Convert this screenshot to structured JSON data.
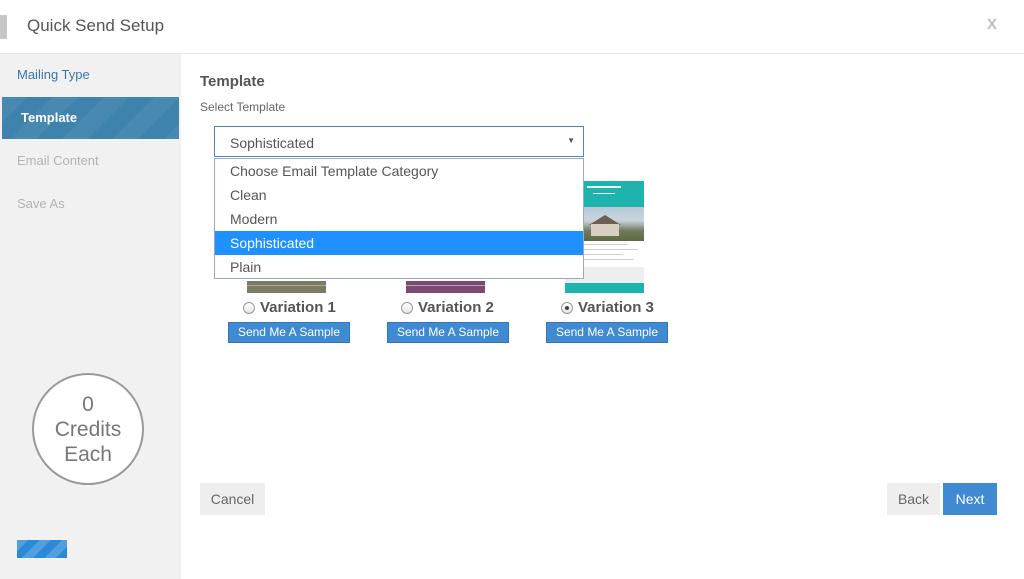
{
  "header": {
    "title": "Quick Send Setup",
    "close_label": "x"
  },
  "sidebar": {
    "items": [
      {
        "label": "Mailing Type",
        "state": "done"
      },
      {
        "label": "Template",
        "state": "active"
      },
      {
        "label": "Email Content",
        "state": "pending"
      },
      {
        "label": "Save As",
        "state": "pending"
      }
    ],
    "credits": {
      "count": "0",
      "line1": "Credits",
      "line2": "Each"
    }
  },
  "main": {
    "section_title": "Template",
    "select_label": "Select Template",
    "select": {
      "value": "Sophisticated",
      "caret": "▼",
      "options": [
        "Choose Email Template Category",
        "Clean",
        "Modern",
        "Sophisticated",
        "Plain"
      ],
      "selected_index": 3
    },
    "variations": [
      {
        "label": "Variation 1",
        "checked": false,
        "button": "Send Me A Sample"
      },
      {
        "label": "Variation 2",
        "checked": false,
        "button": "Send Me A Sample"
      },
      {
        "label": "Variation 3",
        "checked": true,
        "button": "Send Me A Sample"
      }
    ]
  },
  "footer": {
    "cancel": "Cancel",
    "back": "Back",
    "next": "Next"
  },
  "colors": {
    "accent": "#3f8ad2",
    "active_step": "#3e83ad",
    "dropdown_highlight": "#1e90ff",
    "template_teal": "#1fb3ad"
  }
}
